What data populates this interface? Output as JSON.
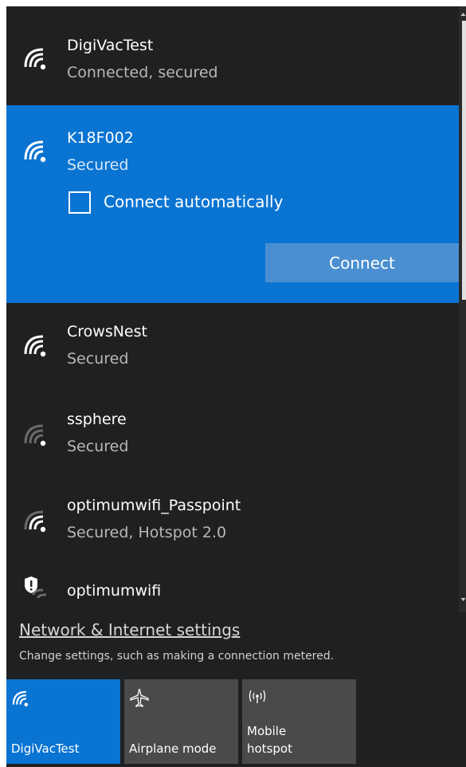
{
  "networks": [
    {
      "ssid": "DigiVacTest",
      "status": "Connected, secured",
      "signal": "strong"
    },
    {
      "ssid": "K18F002",
      "status": "Secured",
      "signal": "strong",
      "selected": true
    },
    {
      "ssid": "CrowsNest",
      "status": "Secured",
      "signal": "strong"
    },
    {
      "ssid": "ssphere",
      "status": "Secured",
      "signal": "weak"
    },
    {
      "ssid": "optimumwifi_Passpoint",
      "status": "Secured, Hotspot 2.0",
      "signal": "medium"
    },
    {
      "ssid": "optimumwifi",
      "status": "",
      "signal": "open-warning"
    }
  ],
  "selected_network": {
    "connect_automatically_label": "Connect automatically",
    "connect_automatically_checked": false,
    "connect_button_label": "Connect"
  },
  "settings": {
    "link_text": "Network & Internet settings",
    "description": "Change settings, such as making a connection metered."
  },
  "quick_actions": [
    {
      "label": "DigiVacTest",
      "icon": "wifi-icon",
      "active": true
    },
    {
      "label": "Airplane mode",
      "icon": "airplane-icon",
      "active": false
    },
    {
      "label_line1": "Mobile",
      "label_line2": "hotspot",
      "icon": "mobile-hotspot-icon",
      "active": false
    }
  ],
  "colors": {
    "panel_bg": "#1f2022",
    "accent": "#0a74d2",
    "connect_button": "#4a8fd1",
    "tile_inactive": "#4a4a4a",
    "text_primary": "#ffffff",
    "text_secondary": "#b8b8b8"
  }
}
